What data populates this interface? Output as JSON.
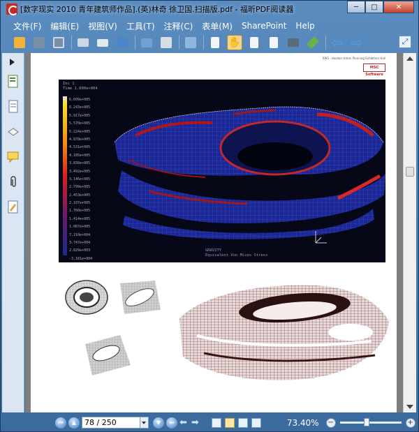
{
  "window": {
    "title": "[数字现实 2010 青年建筑师作品].(英)林奇 徐卫国.扫描版.pdf - 福昕PDF阅读器",
    "controls": {
      "minimize": "─",
      "maximize": "□",
      "close": "✕"
    }
  },
  "menu": {
    "items": [
      "文件(F)",
      "编辑(E)",
      "视图(V)",
      "工具(T)",
      "注释(C)",
      "表单(M)",
      "SharePoint",
      "Help"
    ]
  },
  "toolbar": {
    "buttons": [
      {
        "icon": "open-folder-icon",
        "color": "#f0b43a"
      },
      {
        "icon": "save-icon",
        "color": "#7a8fa8"
      },
      {
        "icon": "save-as-icon",
        "color": "#7a8fa8"
      },
      {
        "icon": "print-icon",
        "color": "#cfd8e2"
      },
      {
        "icon": "email-icon",
        "color": "#e2e8ef"
      },
      {
        "icon": "scan-icon",
        "color": "#4a86c8"
      },
      {
        "icon": "monitor-icon",
        "color": "#6fa3d8"
      },
      {
        "icon": "find-icon",
        "color": "#d6dde6"
      },
      {
        "icon": "multi-window-icon",
        "color": "#8fb6de"
      },
      {
        "icon": "document-icon",
        "color": "#f2f5f9"
      },
      {
        "icon": "hand-tool-icon",
        "color": "#f3d28a"
      },
      {
        "icon": "select-text-icon",
        "color": "#f2f5f9"
      },
      {
        "icon": "text-tool-icon",
        "color": "#f2f5f9"
      },
      {
        "icon": "snapshot-icon",
        "color": "#5b6b7e"
      },
      {
        "icon": "sign-icon",
        "color": "#6ab04c"
      },
      {
        "icon": "back-arrow-icon",
        "color": "#4f9de8"
      },
      {
        "icon": "forward-arrow-icon",
        "color": "#4f9de8"
      }
    ]
  },
  "sidebar": {
    "icons": [
      "bookmarks-icon",
      "pages-icon",
      "layers-icon",
      "comments-icon",
      "attachments-icon",
      "signatures-icon"
    ]
  },
  "page": {
    "header_text": "KWS - Hasdan Urban Planning Exhibition Hall",
    "logo_text": "MSC Software",
    "fea": {
      "meta_lines": [
        "Inc    1",
        "Time   1.000e+004"
      ],
      "legend_levels": [
        "6.609e+005",
        "6.243e+005",
        "5.917e+005",
        "5.570e+005",
        "5.224e+005",
        "4.878e+005",
        "4.531e+005",
        "4.185e+005",
        "3.838e+005",
        "3.492e+005",
        "3.146e+005",
        "2.799e+005",
        "2.453e+005",
        "2.107e+005",
        "1.760e+005",
        "1.414e+005",
        "1.067e+005",
        "7.210e+004",
        "3.747e+004",
        "2.829e+003",
        "-3.181e+004"
      ],
      "footer_lines": [
        "GRAVITY",
        "Equivalent Von Mises Stress"
      ]
    }
  },
  "statusbar": {
    "page_value": "78 / 250",
    "zoom_value": "73.40%"
  }
}
